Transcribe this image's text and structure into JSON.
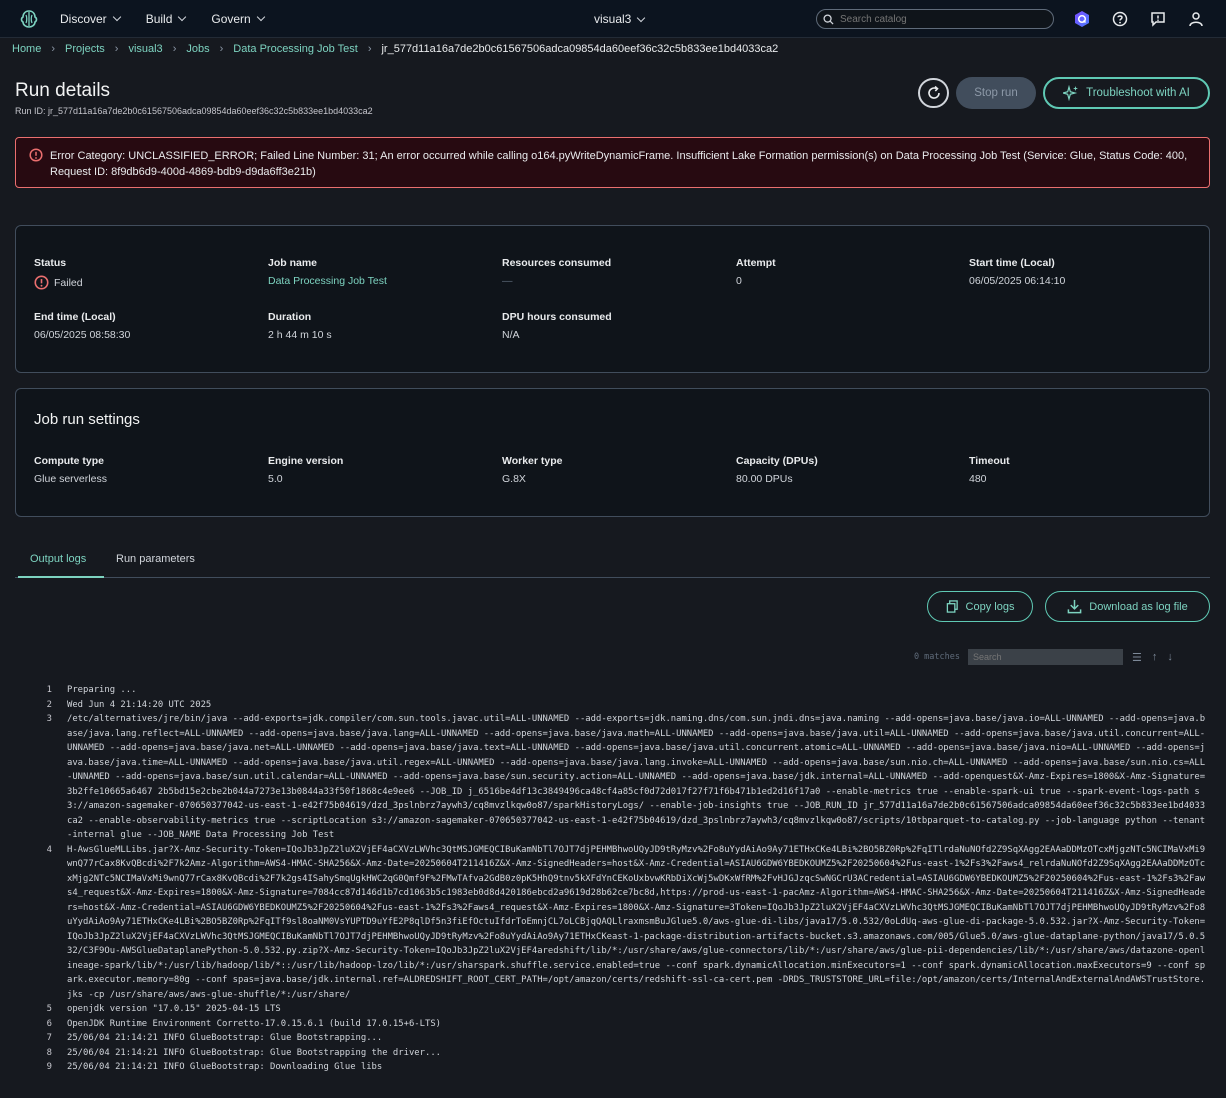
{
  "nav": {
    "items": [
      "Discover",
      "Build",
      "Govern"
    ],
    "project": "visual3",
    "search_placeholder": "Search catalog",
    "icons": [
      "amazon-q-icon",
      "help-icon",
      "feedback-icon",
      "user-icon"
    ]
  },
  "breadcrumb": [
    "Home",
    "Projects",
    "visual3",
    "Jobs",
    "Data Processing Job Test",
    "jr_577d11a16a7de2b0c61567506adca09854da60eef36c32c5b833ee1bd4033ca2"
  ],
  "header": {
    "title": "Run details",
    "run_id": "Run ID: jr_577d11a16a7de2b0c61567506adca09854da60eef36c32c5b833ee1bd4033ca2",
    "stop_label": "Stop run",
    "troubleshoot_label": "Troubleshoot with AI"
  },
  "error": {
    "text": "Error Category: UNCLASSIFIED_ERROR; Failed Line Number: 31; An error occurred while calling o164.pyWriteDynamicFrame. Insufficient Lake Formation permission(s) on Data Processing Job Test (Service: Glue, Status Code: 400, Request ID: 8f9db6d9-400d-4869-bdb9-d9da6ff3e21b)"
  },
  "summary": {
    "status_label": "Status",
    "status_value": "Failed",
    "job_label": "Job name",
    "job_value": "Data Processing Job Test",
    "resources_label": "Resources consumed",
    "resources_value": "—",
    "attempt_label": "Attempt",
    "attempt_value": "0",
    "start_label": "Start time (Local)",
    "start_value": "06/05/2025 06:14:10",
    "end_label": "End time (Local)",
    "end_value": "06/05/2025 08:58:30",
    "duration_label": "Duration",
    "duration_value": "2 h 44 m 10 s",
    "dpu_label": "DPU hours consumed",
    "dpu_value": "N/A"
  },
  "settings": {
    "title": "Job run settings",
    "compute_label": "Compute type",
    "compute_value": "Glue serverless",
    "engine_label": "Engine version",
    "engine_value": "5.0",
    "worker_label": "Worker type",
    "worker_value": "G.8X",
    "capacity_label": "Capacity (DPUs)",
    "capacity_value": "80.00 DPUs",
    "timeout_label": "Timeout",
    "timeout_value": "480"
  },
  "tabs": [
    "Output logs",
    "Run parameters"
  ],
  "actions": {
    "copy_label": "Copy logs",
    "download_label": "Download as log file"
  },
  "logsearch": {
    "matches": "0 matches",
    "placeholder": "Search"
  },
  "logs": [
    {
      "n": "1",
      "t": "Preparing ..."
    },
    {
      "n": "2",
      "t": "Wed Jun 4 21:14:20 UTC 2025"
    },
    {
      "n": "3",
      "t": "/etc/alternatives/jre/bin/java --add-exports=jdk.compiler/com.sun.tools.javac.util=ALL-UNNAMED --add-exports=jdk.naming.dns/com.sun.jndi.dns=java.naming --add-opens=java.base/java.io=ALL-UNNAMED --add-opens=java.base/java.lang.reflect=ALL-UNNAMED --add-opens=java.base/java.lang=ALL-UNNAMED --add-opens=java.base/java.math=ALL-UNNAMED --add-opens=java.base/java.util=ALL-UNNAMED --add-opens=java.base/java.util.concurrent=ALL-UNNAMED --add-opens=java.base/java.net=ALL-UNNAMED --add-opens=java.base/java.text=ALL-UNNAMED --add-opens=java.base/java.util.concurrent.atomic=ALL-UNNAMED --add-opens=java.base/java.nio=ALL-UNNAMED --add-opens=java.base/java.time=ALL-UNNAMED --add-opens=java.base/java.util.regex=ALL-UNNAMED --add-opens=java.base/java.lang.invoke=ALL-UNNAMED --add-opens=java.base/sun.nio.ch=ALL-UNNAMED --add-opens=java.base/sun.nio.cs=ALL-UNNAMED --add-opens=java.base/sun.util.calendar=ALL-UNNAMED --add-opens=java.base/sun.security.action=ALL-UNNAMED --add-opens=java.base/jdk.internal=ALL-UNNAMED --add-openquest&X-Amz-Expires=1800&X-Amz-Signature=3b2ffe10665a6467 2b5bd15e2cbe2b044a7273e13b0844a33f50f1868c4e9ee6 --JOB_ID j_6516be4df13c3849496ca48cf4a85cf0d72d017f27f71f6b471b1ed2d16f17a0 --enable-metrics true --enable-spark-ui true --spark-event-logs-path s3://amazon-sagemaker-070650377042-us-east-1-e42f75b04619/dzd_3pslnbrz7aywh3/cq8mvzlkqw0o87/sparkHistoryLogs/ --enable-job-insights true --JOB_RUN_ID jr_577d11a16a7de2b0c61567506adca09854da60eef36c32c5b833ee1bd4033ca2 --enable-observability-metrics true --scriptLocation s3://amazon-sagemaker-070650377042-us-east-1-e42f75b04619/dzd_3pslnbrz7aywh3/cq8mvzlkqw0o87/scripts/10tbparquet-to-catalog.py --job-language python --tenant-internal glue --JOB_NAME Data Processing Job Test"
    },
    {
      "n": "4",
      "t": "H-AwsGlueMLLibs.jar?X-Amz-Security-Token=IQoJb3JpZ2luX2VjEF4aCXVzLWVhc3QtMSJGMEQCIBuKamNbTl7OJT7djPEHMBhwoUQyJD9tRyMzv%2Fo8uYydAiAo9Ay71ETHxCKe4LBi%2BO5BZ0Rp%2FqITlrdaNuNOfd2Z9SqXAgg2EAAaDDMzOTcxMjgzNTc5NCIMaVxMi9wnQ77rCax8KvQBcdi%2F7k2Amz-Algorithm=AWS4-HMAC-SHA256&X-Amz-Date=20250604T211416Z&X-Amz-SignedHeaders=host&X-Amz-Credential=ASIAU6GDW6YBEDKOUMZ5%2F20250604%2Fus-east-1%2Fs3%2Faws4_relrdaNuNOfd2Z9SqXAgg2EAAaDDMzOTcxMjg2NTc5NCIMaVxMi9wnQ77rCax8KvQBcdi%2F7k2gs4ISahySmqUgkHWC2qG0Qmf9F%2FMwTAfva2GdB0z0pK5HhQ9tnv5kXFdYnCEKoUxbvwKRbDiXcWj5wDKxWfRM%2FvHJGJzqcSwNGCrU3ACredential=ASIAU6GDW6YBEDKOUMZ5%2F20250604%2Fus-east-1%2Fs3%2Faws4_request&X-Amz-Expires=1800&X-Amz-Signature=7084cc87d146d1b7cd1063b5c1983eb0d8d420186ebcd2a9619d28b62ce7bc8d,https://prod-us-east-1-pacAmz-Algorithm=AWS4-HMAC-SHA256&X-Amz-Date=20250604T211416Z&X-Amz-SignedHeaders=host&X-Amz-Credential=ASIAU6GDW6YBEDKOUMZ5%2F20250604%2Fus-east-1%2Fs3%2Faws4_request&X-Amz-Expires=1800&X-Amz-Signature=3Token=IQoJb3JpZ2luX2VjEF4aCXVzLWVhc3QtMSJGMEQCIBuKamNbTl7OJT7djPEHMBhwoUQyJD9tRyMzv%2Fo8uYydAiAo9Ay71ETHxCKe4LBi%2BO5BZ0Rp%2FqITf9sl8oaNM0VsYUPTD9uYfE2P8qlDf5n3fiEfOctuIfdrToEmnjCL7oLCBjqQAQLlraxmsmBuJGlue5.0/aws-glue-di-libs/java17/5.0.532/0oLdUq-aws-glue-di-package-5.0.532.jar?X-Amz-Security-Token=IQoJb3JpZ2luX2VjEF4aCXVzLWVhc3QtMSJGMEQCIBuKamNbTl7OJT7djPEHMBhwoUQyJD9tRyMzv%2Fo8uYydAiAo9Ay71ETHxCKeast-1-package-distribution-artifacts-bucket.s3.amazonaws.com/005/Glue5.0/aws-glue-dataplane-python/java17/5.0.532/C3F9Ou-AWSGlueDataplanePython-5.0.532.py.zip?X-Amz-Security-Token=IQoJb3JpZ2luX2VjEF4aredshift/lib/*:/usr/share/aws/glue-connectors/lib/*:/usr/share/aws/glue-pii-dependencies/lib/*:/usr/share/aws/datazone-openlineage-spark/lib/*:/usr/lib/hadoop/lib/*::/usr/lib/hadoop-lzo/lib/*:/usr/sharspark.shuffle.service.enabled=true --conf spark.dynamicAllocation.minExecutors=1 --conf spark.dynamicAllocation.maxExecutors=9 --conf spark.executor.memory=80g --conf spas=java.base/jdk.internal.ref=ALDREDSHIFT_ROOT_CERT_PATH=/opt/amazon/certs/redshift-ssl-ca-cert.pem -DRDS_TRUSTSTORE_URL=file:/opt/amazon/certs/InternalAndExternalAndAWSTrustStore.jks -cp /usr/share/aws/aws-glue-shuffle/*:/usr/share/"
    },
    {
      "n": "5",
      "t": "openjdk version \"17.0.15\" 2025-04-15 LTS"
    },
    {
      "n": "6",
      "t": "OpenJDK Runtime Environment Corretto-17.0.15.6.1 (build 17.0.15+6-LTS)"
    },
    {
      "n": "7",
      "t": "25/06/04 21:14:21 INFO GlueBootstrap: Glue Bootstrapping..."
    },
    {
      "n": "8",
      "t": "25/06/04 21:14:21 INFO GlueBootstrap: Glue Bootstrapping the driver..."
    },
    {
      "n": "9",
      "t": "25/06/04 21:14:21 INFO GlueBootstrap: Downloading Glue libs"
    }
  ]
}
